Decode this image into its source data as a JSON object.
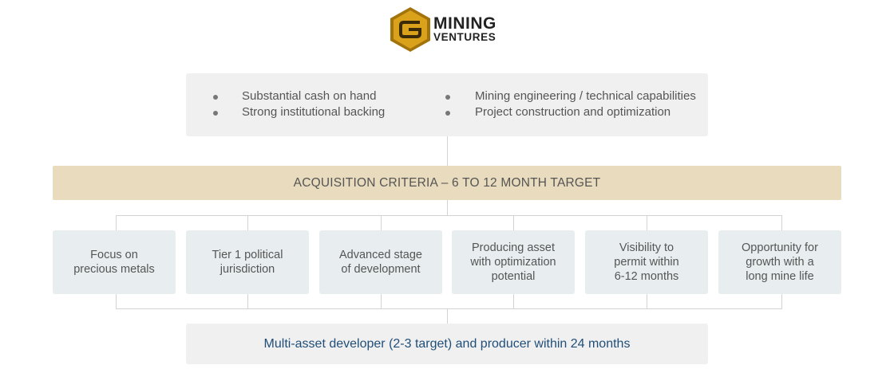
{
  "logo": {
    "line1": "MINING",
    "line2": "VENTURES",
    "colors": {
      "gold": "#d9a21a",
      "dark_gold": "#a3730d",
      "text": "#222222"
    }
  },
  "strengths": {
    "left": [
      "Substantial cash on hand",
      "Strong institutional backing"
    ],
    "right": [
      "Mining engineering / technical capabilities",
      "Project construction and optimization"
    ]
  },
  "banner": {
    "label": "ACQUISITION CRITERIA – 6 TO 12 MONTH TARGET",
    "color": "#e9dbbe"
  },
  "criteria": [
    {
      "lines": [
        "Focus on",
        "precious metals"
      ]
    },
    {
      "lines": [
        "Tier 1 political",
        "jurisdiction"
      ]
    },
    {
      "lines": [
        "Advanced stage",
        "of development"
      ]
    },
    {
      "lines": [
        "Producing asset",
        "with optimization",
        "potential"
      ]
    },
    {
      "lines": [
        "Visibility to",
        "permit within",
        "6-12 months"
      ]
    },
    {
      "lines": [
        "Opportunity for",
        "growth with a",
        "long mine life"
      ]
    }
  ],
  "outcome": {
    "label": "Multi-asset developer (2-3 target) and producer within 24 months",
    "color": "#1f4e79"
  }
}
